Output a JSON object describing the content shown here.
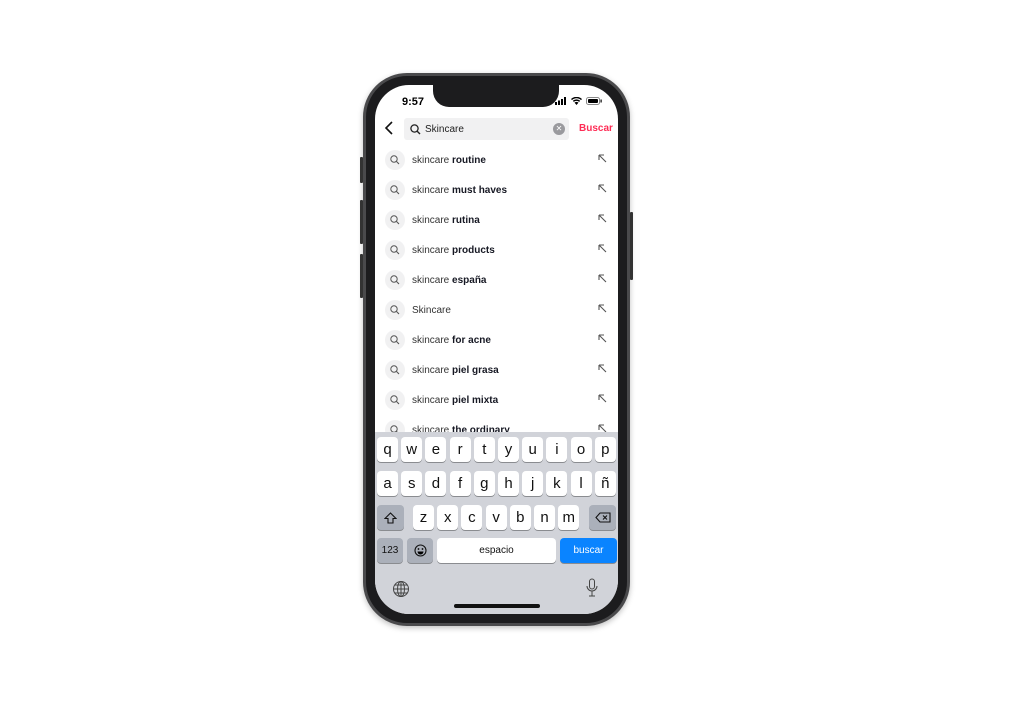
{
  "status": {
    "time": "9:57"
  },
  "search": {
    "value": "Skincare",
    "submit_label": "Buscar"
  },
  "suggestions": [
    {
      "prefix": "skincare",
      "bold": "routine"
    },
    {
      "prefix": "skincare",
      "bold": "must haves"
    },
    {
      "prefix": "skincare",
      "bold": "rutina"
    },
    {
      "prefix": "skincare",
      "bold": "products"
    },
    {
      "prefix": "skincare",
      "bold": "españa"
    },
    {
      "prefix": "Skincare",
      "bold": ""
    },
    {
      "prefix": "skincare",
      "bold": "for acne"
    },
    {
      "prefix": "skincare",
      "bold": "piel grasa"
    },
    {
      "prefix": "skincare",
      "bold": "piel mixta"
    },
    {
      "prefix": "skincare",
      "bold": "the ordinary"
    }
  ],
  "keyboard": {
    "row1": [
      "q",
      "w",
      "e",
      "r",
      "t",
      "y",
      "u",
      "i",
      "o",
      "p"
    ],
    "row2": [
      "a",
      "s",
      "d",
      "f",
      "g",
      "h",
      "j",
      "k",
      "l",
      "ñ"
    ],
    "row3": [
      "z",
      "x",
      "c",
      "v",
      "b",
      "n",
      "m"
    ],
    "numbers_label": "123",
    "space_label": "espacio",
    "search_label": "buscar"
  },
  "colors": {
    "accent": "#fe2c55",
    "keyboard_action": "#0a84ff"
  }
}
